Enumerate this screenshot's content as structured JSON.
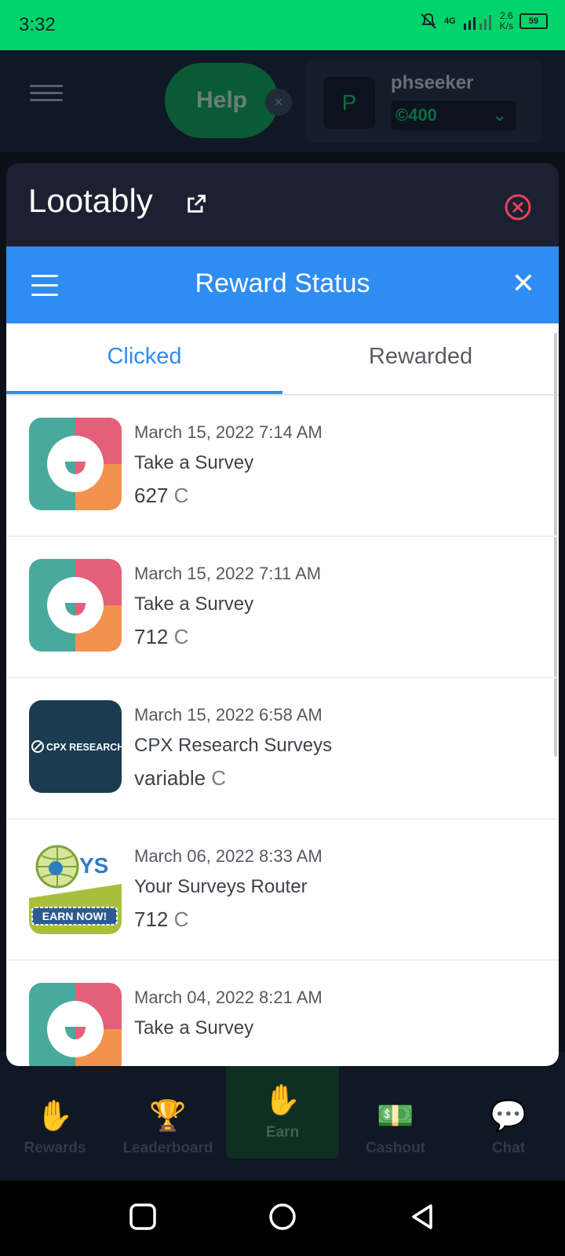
{
  "status_bar": {
    "time": "3:32",
    "net_speed_top": "2.6",
    "net_speed_bottom": "K/s",
    "network_type": "4G",
    "battery": "59"
  },
  "app_header": {
    "help_label": "Help",
    "help_close": "×",
    "user_initial": "P",
    "username": "phseeker",
    "coins": "©400"
  },
  "modal": {
    "title": "Lootably"
  },
  "reward_status": {
    "title": "Reward Status",
    "tabs": [
      "Clicked",
      "Rewarded"
    ],
    "active_tab": "Clicked",
    "items": [
      {
        "date": "March 15, 2022 7:14 AM",
        "name": "Take a Survey",
        "amount": "627",
        "unit": "C",
        "thumb": "lootably-survey"
      },
      {
        "date": "March 15, 2022 7:11 AM",
        "name": "Take a Survey",
        "amount": "712",
        "unit": "C",
        "thumb": "lootably-survey"
      },
      {
        "date": "March 15, 2022 6:58 AM",
        "name": "CPX Research Surveys",
        "amount": "variable",
        "unit": "C",
        "thumb": "cpx-research",
        "thumb_text": "CPX RESEARCH"
      },
      {
        "date": "March 06, 2022 8:33 AM",
        "name": "Your Surveys Router",
        "amount": "712",
        "unit": "C",
        "thumb": "your-surveys",
        "thumb_text": "YS",
        "thumb_button": "EARN NOW!"
      },
      {
        "date": "March 04, 2022 8:21 AM",
        "name": "Take a Survey",
        "amount": "",
        "unit": "",
        "thumb": "lootably-survey"
      }
    ]
  },
  "bottom_nav": {
    "items": [
      "Rewards",
      "Leaderboard",
      "Earn",
      "Cashout",
      "Chat"
    ]
  },
  "colors": {
    "status_bar": "#00d46a",
    "accent_blue": "#2f8cf2",
    "modal_bg": "#1b2131",
    "close_red": "#e8435a"
  }
}
